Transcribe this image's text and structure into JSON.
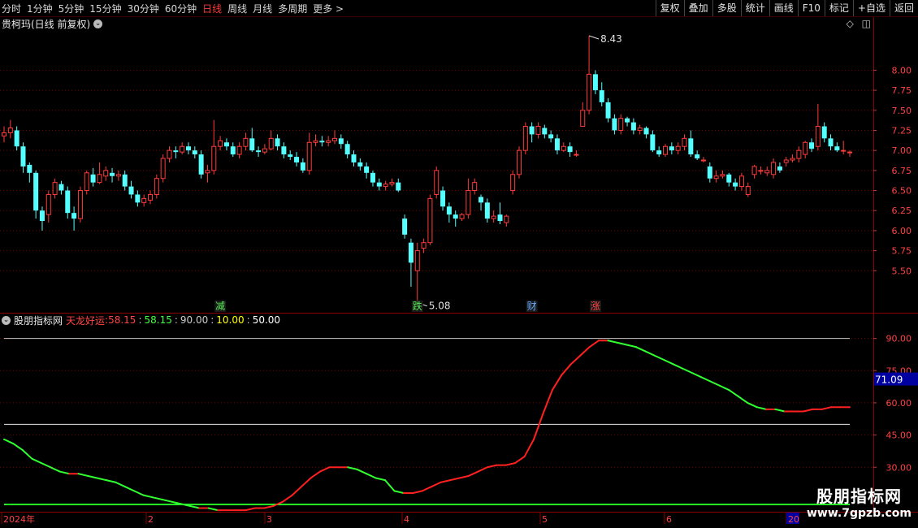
{
  "toolbar": {
    "periods": [
      "分时",
      "1分钟",
      "5分钟",
      "15分钟",
      "30分钟",
      "60分钟",
      "日线",
      "周线",
      "月线",
      "多周期",
      "更多 >"
    ],
    "active_period": "日线",
    "actions": [
      "复权",
      "叠加",
      "多股",
      "统计",
      "画线",
      "F10",
      "标记",
      "+自选",
      "返回"
    ]
  },
  "main": {
    "title": "贵柯玛(日线 前复权)",
    "high_label": "8.43",
    "low_label": "5.08",
    "markers": [
      {
        "text": "减",
        "color": "#55ee55"
      },
      {
        "text": "跌",
        "color": "#55ee55"
      },
      {
        "text": "财",
        "color": "#66aaff"
      },
      {
        "text": "涨",
        "color": "#ff4444"
      }
    ],
    "y_ticks": [
      "8.00",
      "7.75",
      "7.50",
      "7.25",
      "7.00",
      "6.75",
      "6.50",
      "6.25",
      "6.00",
      "5.75",
      "5.50"
    ]
  },
  "indicator": {
    "name": "股朋指标网",
    "series_name": "天龙好运",
    "values": [
      "58.15",
      "58.15",
      "90.00",
      "10.00",
      "50.00"
    ],
    "value_colors": [
      "#ff4444",
      "#44ff44",
      "#cccccc",
      "#ffff00",
      "#ffffff"
    ],
    "y_ticks": [
      "90.00",
      "75.00",
      "60.00",
      "45.00",
      "30.00"
    ],
    "cursor_value": "71.09"
  },
  "xaxis": {
    "labels": [
      "2024年",
      "2",
      "3",
      "4",
      "5",
      "6",
      "20"
    ]
  },
  "watermark": {
    "line1": "股朋指标网",
    "line2": "www.7gpzb.com"
  },
  "colors": {
    "up": "#ff3b3b",
    "down": "#54ffff",
    "grid": "#7a0000",
    "ind_up": "#ff2020",
    "ind_down": "#30ff30"
  },
  "chart_data": {
    "type": "candlestick",
    "candles": [
      [
        7.18,
        7.22,
        7.3,
        7.1
      ],
      [
        7.22,
        7.28,
        7.38,
        7.15
      ],
      [
        7.25,
        7.05,
        7.3,
        7.0
      ],
      [
        7.05,
        6.8,
        7.1,
        6.72
      ],
      [
        6.82,
        6.72,
        6.85,
        6.6
      ],
      [
        6.72,
        6.25,
        6.75,
        6.15
      ],
      [
        6.25,
        6.12,
        6.3,
        6.0
      ],
      [
        6.2,
        6.45,
        6.5,
        6.1
      ],
      [
        6.45,
        6.6,
        6.65,
        6.4
      ],
      [
        6.58,
        6.5,
        6.62,
        6.45
      ],
      [
        6.5,
        6.22,
        6.55,
        6.15
      ],
      [
        6.22,
        6.15,
        6.3,
        6.0
      ],
      [
        6.15,
        6.5,
        6.55,
        6.1
      ],
      [
        6.5,
        6.72,
        6.75,
        6.45
      ],
      [
        6.7,
        6.6,
        6.78,
        6.55
      ],
      [
        6.6,
        6.7,
        6.85,
        6.58
      ],
      [
        6.68,
        6.75,
        6.8,
        6.62
      ],
      [
        6.72,
        6.68,
        6.78,
        6.6
      ],
      [
        6.68,
        6.7,
        6.75,
        6.62
      ],
      [
        6.7,
        6.55,
        6.75,
        6.5
      ],
      [
        6.55,
        6.45,
        6.62,
        6.4
      ],
      [
        6.45,
        6.35,
        6.5,
        6.3
      ],
      [
        6.35,
        6.4,
        6.45,
        6.3
      ],
      [
        6.38,
        6.45,
        6.5,
        6.33
      ],
      [
        6.45,
        6.65,
        6.7,
        6.4
      ],
      [
        6.65,
        6.9,
        6.95,
        6.6
      ],
      [
        6.9,
        7.0,
        7.05,
        6.85
      ],
      [
        7.0,
        6.98,
        7.05,
        6.9
      ],
      [
        6.98,
        7.05,
        7.1,
        6.95
      ],
      [
        7.05,
        7.0,
        7.1,
        6.95
      ],
      [
        7.0,
        6.95,
        7.05,
        6.9
      ],
      [
        6.95,
        6.7,
        7.0,
        6.65
      ],
      [
        6.72,
        6.75,
        6.82,
        6.6
      ],
      [
        6.75,
        7.05,
        7.38,
        6.7
      ],
      [
        7.05,
        7.12,
        7.18,
        7.0
      ],
      [
        7.1,
        7.05,
        7.15,
        7.0
      ],
      [
        7.05,
        6.95,
        7.1,
        6.92
      ],
      [
        6.95,
        7.05,
        7.1,
        6.9
      ],
      [
        7.05,
        7.15,
        7.22,
        7.0
      ],
      [
        7.15,
        7.0,
        7.28,
        6.98
      ],
      [
        7.0,
        6.98,
        7.05,
        6.92
      ],
      [
        6.98,
        7.02,
        7.08,
        6.95
      ],
      [
        7.02,
        7.15,
        7.25,
        7.0
      ],
      [
        7.15,
        7.05,
        7.2,
        7.0
      ],
      [
        7.05,
        6.95,
        7.1,
        6.9
      ],
      [
        6.95,
        6.92,
        7.0,
        6.88
      ],
      [
        6.92,
        6.85,
        6.98,
        6.8
      ],
      [
        6.85,
        6.75,
        6.9,
        6.72
      ],
      [
        6.75,
        7.1,
        7.22,
        6.7
      ],
      [
        7.1,
        7.12,
        7.2,
        7.05
      ],
      [
        7.12,
        7.1,
        7.18,
        7.05
      ],
      [
        7.1,
        7.12,
        7.18,
        7.05
      ],
      [
        7.12,
        7.15,
        7.25,
        7.08
      ],
      [
        7.15,
        7.08,
        7.2,
        7.02
      ],
      [
        7.08,
        6.95,
        7.12,
        6.9
      ],
      [
        6.95,
        6.85,
        7.0,
        6.8
      ],
      [
        6.85,
        6.8,
        6.9,
        6.75
      ],
      [
        6.8,
        6.72,
        6.85,
        6.65
      ],
      [
        6.72,
        6.6,
        6.75,
        6.55
      ],
      [
        6.6,
        6.55,
        6.65,
        6.5
      ],
      [
        6.55,
        6.58,
        6.62,
        6.5
      ],
      [
        6.58,
        6.6,
        6.65,
        6.55
      ],
      [
        6.6,
        6.5,
        6.65,
        6.48
      ],
      [
        6.15,
        5.95,
        6.2,
        5.9
      ],
      [
        5.85,
        5.6,
        5.9,
        5.3
      ],
      [
        5.5,
        5.75,
        5.85,
        5.1
      ],
      [
        5.78,
        5.85,
        5.9,
        5.72
      ],
      [
        5.85,
        6.4,
        6.45,
        5.82
      ],
      [
        6.45,
        6.75,
        6.8,
        6.4
      ],
      [
        6.5,
        6.3,
        6.55,
        6.25
      ],
      [
        6.3,
        6.2,
        6.35,
        6.1
      ],
      [
        6.2,
        6.15,
        6.25,
        6.05
      ],
      [
        6.15,
        6.2,
        6.22,
        6.12
      ],
      [
        6.2,
        6.5,
        6.65,
        6.15
      ],
      [
        6.5,
        6.6,
        6.65,
        6.45
      ],
      [
        6.42,
        6.35,
        6.45,
        6.25
      ],
      [
        6.35,
        6.15,
        6.4,
        6.1
      ],
      [
        6.15,
        6.18,
        6.25,
        6.1
      ],
      [
        6.2,
        6.12,
        6.35,
        6.08
      ],
      [
        6.1,
        6.18,
        6.2,
        6.05
      ],
      [
        6.5,
        6.7,
        6.75,
        6.45
      ],
      [
        6.7,
        7.0,
        7.05,
        6.65
      ],
      [
        7.0,
        7.3,
        7.35,
        6.95
      ],
      [
        7.3,
        7.2,
        7.35,
        7.1
      ],
      [
        7.2,
        7.3,
        7.35,
        7.15
      ],
      [
        7.28,
        7.2,
        7.32,
        7.15
      ],
      [
        7.2,
        7.15,
        7.25,
        7.1
      ],
      [
        7.15,
        7.0,
        7.2,
        6.95
      ],
      [
        7.0,
        7.05,
        7.1,
        6.98
      ],
      [
        7.05,
        6.98,
        7.1,
        6.92
      ],
      [
        6.95,
        6.95,
        7.0,
        6.92
      ],
      [
        7.3,
        7.5,
        7.6,
        7.35
      ],
      [
        7.5,
        7.95,
        8.43,
        7.45
      ],
      [
        7.95,
        7.75,
        8.0,
        7.7
      ],
      [
        7.75,
        7.6,
        7.85,
        7.55
      ],
      [
        7.6,
        7.4,
        7.65,
        7.35
      ],
      [
        7.4,
        7.25,
        7.45,
        7.2
      ],
      [
        7.25,
        7.4,
        7.45,
        7.2
      ],
      [
        7.4,
        7.35,
        7.42,
        7.3
      ],
      [
        7.35,
        7.25,
        7.4,
        7.2
      ],
      [
        7.25,
        7.28,
        7.32,
        7.2
      ],
      [
        7.28,
        7.2,
        7.3,
        7.15
      ],
      [
        7.2,
        7.0,
        7.25,
        6.98
      ],
      [
        7.0,
        6.95,
        7.05,
        6.92
      ],
      [
        6.95,
        7.05,
        7.08,
        6.92
      ],
      [
        7.05,
        7.0,
        7.1,
        6.95
      ],
      [
        7.0,
        7.05,
        7.1,
        6.95
      ],
      [
        7.05,
        7.15,
        7.2,
        7.0
      ],
      [
        7.15,
        6.95,
        7.25,
        6.92
      ],
      [
        6.95,
        6.9,
        7.0,
        6.88
      ],
      [
        6.88,
        6.88,
        6.92,
        6.85
      ],
      [
        6.8,
        6.65,
        6.85,
        6.6
      ],
      [
        6.65,
        6.68,
        6.75,
        6.6
      ],
      [
        6.68,
        6.7,
        6.75,
        6.65
      ],
      [
        6.7,
        6.6,
        6.72,
        6.55
      ],
      [
        6.6,
        6.55,
        6.65,
        6.5
      ],
      [
        6.55,
        6.68,
        6.72,
        6.5
      ],
      [
        6.45,
        6.55,
        6.6,
        6.42
      ],
      [
        6.7,
        6.8,
        6.82,
        6.65
      ],
      [
        6.75,
        6.75,
        6.8,
        6.7
      ],
      [
        6.72,
        6.75,
        6.8,
        6.68
      ],
      [
        6.7,
        6.85,
        6.9,
        6.65
      ],
      [
        6.8,
        6.75,
        6.85,
        6.72
      ],
      [
        6.85,
        6.88,
        6.92,
        6.8
      ],
      [
        6.88,
        6.9,
        6.95,
        6.85
      ],
      [
        6.9,
        7.0,
        7.05,
        6.85
      ],
      [
        6.95,
        7.1,
        7.12,
        6.9
      ],
      [
        7.1,
        7.02,
        7.15,
        6.98
      ],
      [
        7.05,
        7.3,
        7.58,
        7.0
      ],
      [
        7.3,
        7.15,
        7.35,
        7.1
      ],
      [
        7.15,
        7.05,
        7.2,
        7.0
      ],
      [
        7.05,
        7.0,
        7.1,
        6.98
      ],
      [
        7.0,
        7.0,
        7.12,
        6.95
      ],
      [
        6.98,
        6.98,
        7.0,
        6.92
      ]
    ],
    "ylim": [
      5.3,
      8.45
    ],
    "indicator_series": {
      "name": "天龙好运",
      "ylim": [
        18,
        94
      ],
      "ref_lines": [
        90,
        50,
        10
      ],
      "values": [
        43,
        41,
        38,
        34,
        32,
        30,
        28,
        27,
        27,
        26,
        25,
        24,
        23,
        21,
        19,
        17,
        16,
        15,
        14,
        13,
        12,
        11,
        11,
        10,
        10,
        10,
        10,
        11,
        11,
        12,
        14,
        17,
        21,
        25,
        28,
        30,
        30,
        30,
        29,
        27,
        25,
        24,
        19,
        18,
        18,
        19,
        21,
        23,
        24,
        25,
        26,
        28,
        30,
        31,
        31,
        32,
        35,
        43,
        55,
        66,
        73,
        78,
        82,
        86,
        89,
        89,
        88,
        87,
        86,
        84,
        82,
        80,
        78,
        76,
        74,
        72,
        70,
        68,
        66,
        63,
        60,
        58,
        57,
        57,
        56,
        56,
        56,
        57,
        57,
        58,
        58,
        58
      ]
    }
  }
}
